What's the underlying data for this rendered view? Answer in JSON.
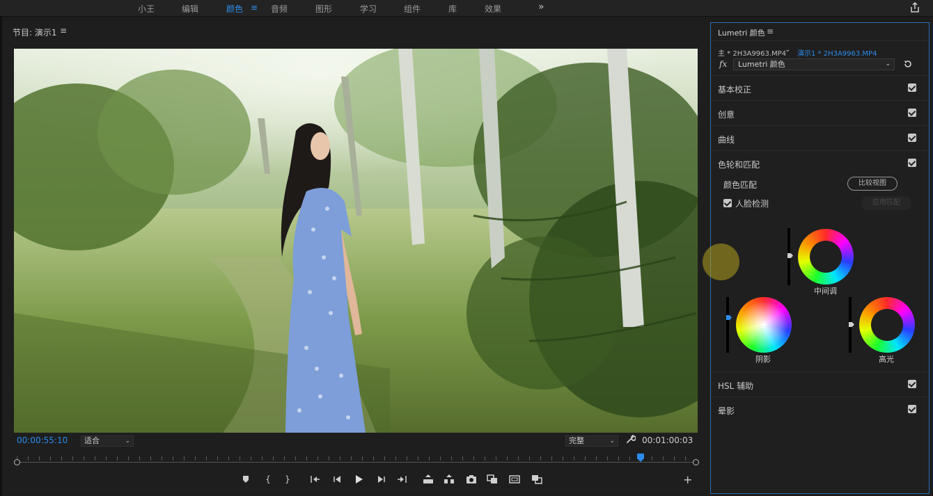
{
  "workspaces": {
    "items": [
      "小王",
      "编辑",
      "颜色",
      "音频",
      "图形",
      "学习",
      "组件",
      "库",
      "效果"
    ],
    "active": "颜色",
    "overflow_icon": "double-chevron-right-icon",
    "share_icon": "share-icon"
  },
  "program": {
    "title": "节目: 演示1",
    "menu_icon": "hamburger-menu-icon",
    "timecode_current": "00:00:55:10",
    "fit_value": "适合",
    "quality_value": "完整",
    "timecode_duration": "00:01:00:03",
    "transport_icons": [
      "marker-icon",
      "mark-in-icon",
      "mark-out-icon",
      "go-to-in-icon",
      "step-back-icon",
      "play-icon",
      "step-forward-icon",
      "go-to-out-icon",
      "lift-icon",
      "extract-icon",
      "camera-icon",
      "compare-view-icon",
      "safe-margins-icon",
      "proxy-toggle-icon"
    ],
    "add_label": "+",
    "playhead_fraction": 0.92
  },
  "lumetri": {
    "title": "Lumetri 颜色",
    "master_clip": "主 * 2H3A9963.MP4",
    "sequence_clip": "演示1 * 2H3A9963.MP4",
    "fx_label": "fx",
    "effect_value": "Lumetri 颜色",
    "sections": [
      {
        "label": "基本校正",
        "checked": true
      },
      {
        "label": "创意",
        "checked": true
      },
      {
        "label": "曲线",
        "checked": true
      },
      {
        "label": "色轮和匹配",
        "checked": true
      },
      {
        "label": "HSL 辅助",
        "checked": true
      },
      {
        "label": "晕影",
        "checked": true
      }
    ],
    "color_match_label": "颜色匹配",
    "compare_view_label": "比较视图",
    "face_detect_label": "人脸检测",
    "apply_match_label": "应用匹配",
    "wheels": {
      "midtones": "中间调",
      "shadows": "阴影",
      "highlights": "高光"
    }
  }
}
